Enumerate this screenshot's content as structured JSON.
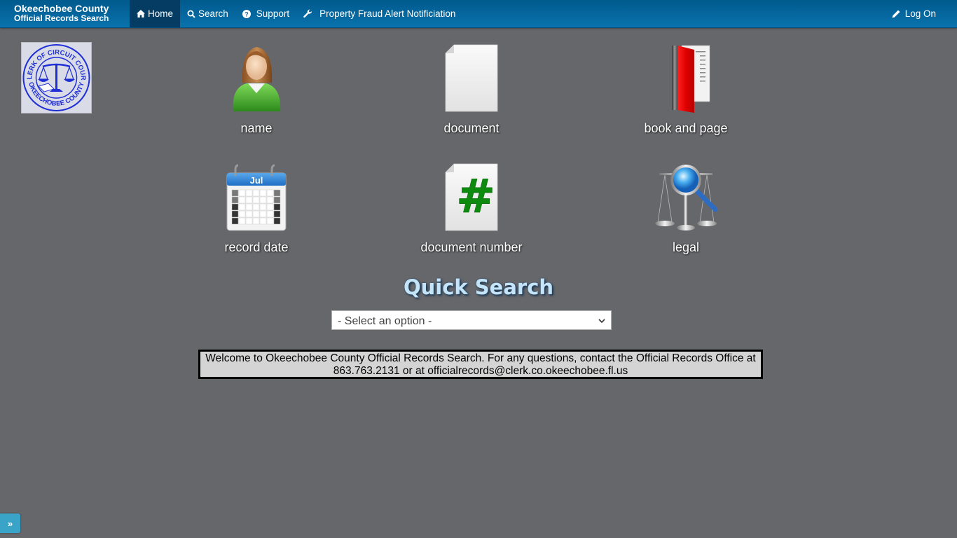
{
  "navbar": {
    "brand_line1": "Okeechobee County",
    "brand_line2": "Official Records Search",
    "items": [
      {
        "label": "Home",
        "icon": "home-icon",
        "active": true
      },
      {
        "label": "Search",
        "icon": "search-icon",
        "active": false
      },
      {
        "label": "Support",
        "icon": "question-circle-icon",
        "active": false
      },
      {
        "label": "Property Fraud Alert Notificiation",
        "icon": "wrench-icon",
        "active": false
      }
    ],
    "login": {
      "label": "Log On",
      "icon": "pencil-icon"
    }
  },
  "logo": {
    "top_text": "CLERK OF CIRCUIT COURT",
    "bottom_text": "OKEECHOBEE COUNTY",
    "icon": "scales-of-justice-seal"
  },
  "tiles": [
    {
      "label": "name",
      "icon": "person-icon"
    },
    {
      "label": "document",
      "icon": "blank-document-icon"
    },
    {
      "label": "book and page",
      "icon": "red-book-icon"
    },
    {
      "label": "record date",
      "icon": "calendar-icon",
      "calendar_month": "Jul"
    },
    {
      "label": "document number",
      "icon": "hash-document-icon",
      "glyph": "#"
    },
    {
      "label": "legal",
      "icon": "scales-magnifier-icon"
    }
  ],
  "quick_search": {
    "title": "Quick Search",
    "selected": "- Select an option -"
  },
  "welcome": {
    "line1": "Welcome to Okeechobee County Official Records Search. For any questions, contact the Official Records Office at",
    "line2": "863.763.2131 or at officialrecords@clerk.co.okeechobee.fl.us"
  },
  "sidebar_toggle": {
    "label": "»"
  }
}
